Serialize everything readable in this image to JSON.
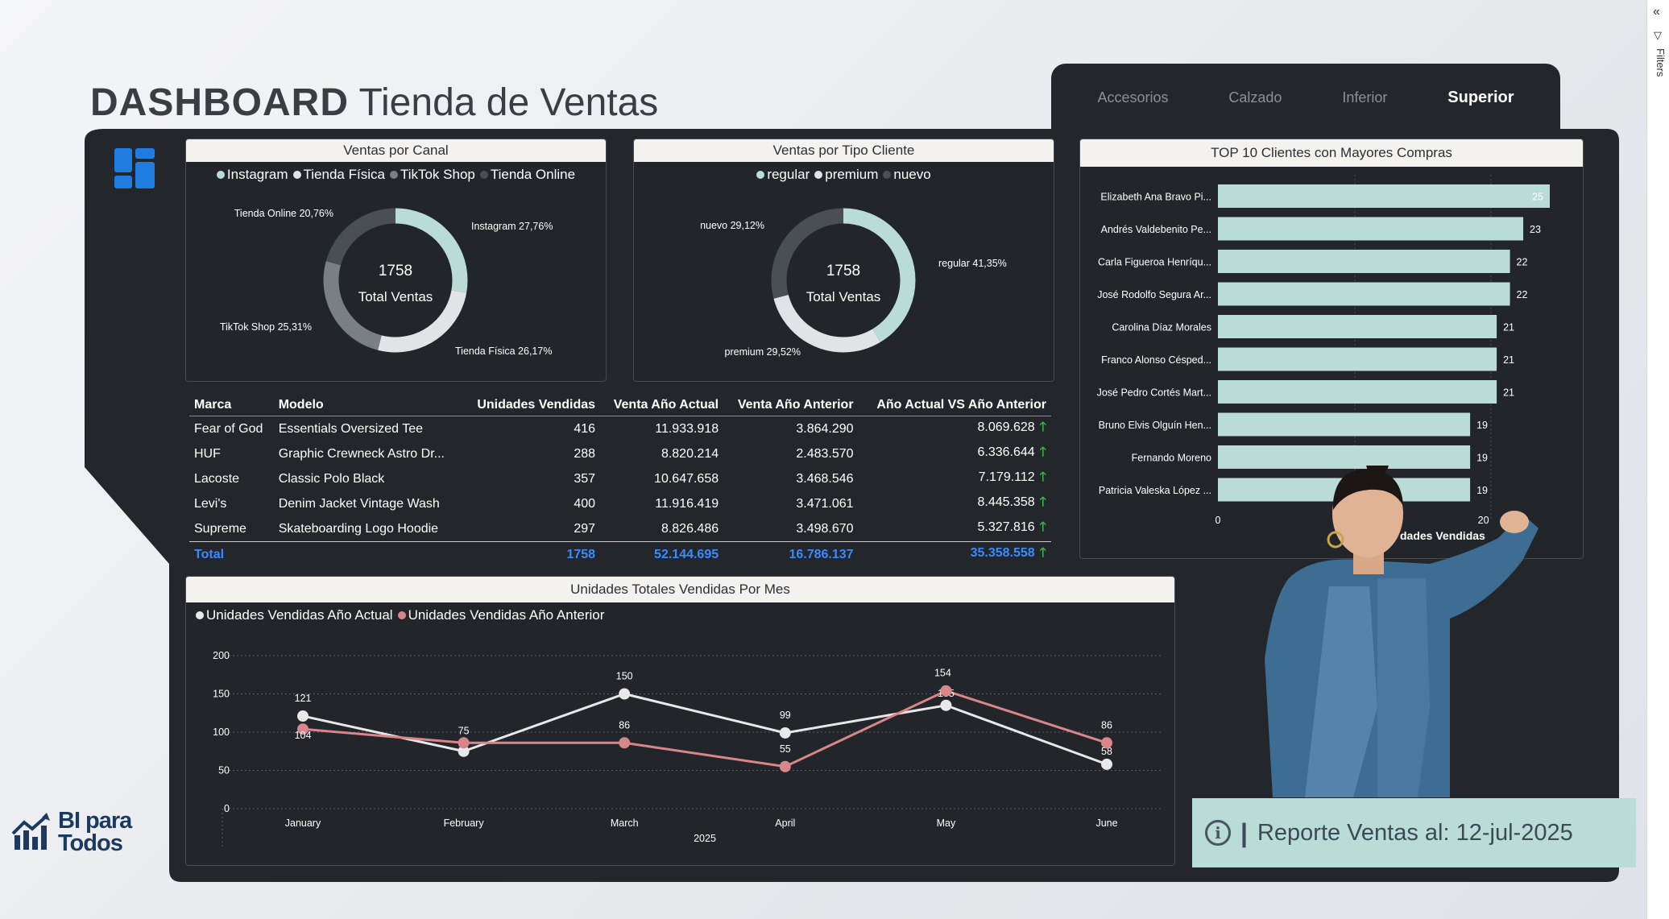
{
  "title": {
    "bold": "DASHBOARD",
    "rest": "Tienda de Ventas"
  },
  "tabs": [
    {
      "label": "Accesorios",
      "active": false
    },
    {
      "label": "Calzado",
      "active": false
    },
    {
      "label": "Inferior",
      "active": false
    },
    {
      "label": "Superior",
      "active": true
    }
  ],
  "filters_pane": {
    "label": "Filters"
  },
  "donut_canal": {
    "header": "Ventas por Canal",
    "center_value": "1758",
    "center_label": "Total Ventas",
    "legend": [
      "Instagram",
      "Tienda Física",
      "TikTok Shop",
      "Tienda Online"
    ],
    "slices": [
      {
        "name": "Instagram",
        "pct": 27.76,
        "label": "Instagram 27,76%",
        "color": "#b9dcd7"
      },
      {
        "name": "Tienda Física",
        "pct": 26.17,
        "label": "Tienda Física 26,17%",
        "color": "#e2e3e6"
      },
      {
        "name": "TikTok Shop",
        "pct": 25.31,
        "label": "TikTok Shop 25,31%",
        "color": "#7a7e85"
      },
      {
        "name": "Tienda Online",
        "pct": 20.76,
        "label": "Tienda Online 20,76%",
        "color": "#4a4e55"
      }
    ]
  },
  "donut_cliente": {
    "header": "Ventas por Tipo Cliente",
    "center_value": "1758",
    "center_label": "Total Ventas",
    "legend": [
      "regular",
      "premium",
      "nuevo"
    ],
    "slices": [
      {
        "name": "regular",
        "pct": 41.35,
        "label": "regular 41,35%",
        "color": "#b9dcd7"
      },
      {
        "name": "premium",
        "pct": 29.52,
        "label": "premium 29,52%",
        "color": "#e2e3e6"
      },
      {
        "name": "nuevo",
        "pct": 29.12,
        "label": "nuevo 29,12%",
        "color": "#4a4e55"
      }
    ]
  },
  "sales_table": {
    "columns": [
      "Marca",
      "Modelo",
      "Unidades Vendidas",
      "Venta Año Actual",
      "Venta Año Anterior",
      "Año Actual VS Año Anterior"
    ],
    "rows": [
      [
        "Fear of God",
        "Essentials Oversized Tee",
        "416",
        "11.933.918",
        "3.864.290",
        "8.069.628"
      ],
      [
        "HUF",
        "Graphic Crewneck Astro Dr...",
        "288",
        "8.820.214",
        "2.483.570",
        "6.336.644"
      ],
      [
        "Lacoste",
        "Classic Polo Black",
        "357",
        "10.647.658",
        "3.468.546",
        "7.179.112"
      ],
      [
        "Levi's",
        "Denim Jacket Vintage Wash",
        "400",
        "11.916.419",
        "3.471.061",
        "8.445.358"
      ],
      [
        "Supreme",
        "Skateboarding Logo Hoodie",
        "297",
        "8.826.486",
        "3.498.670",
        "5.327.816"
      ]
    ],
    "total": [
      "Total",
      "",
      "1758",
      "52.144.695",
      "16.786.137",
      "35.358.558"
    ],
    "arrow_symbol": "🡑"
  },
  "chart_data": [
    {
      "type": "bar",
      "title": "TOP 10 Clientes con Mayores Compras",
      "orientation": "horizontal",
      "categories": [
        "Elizabeth Ana Bravo Pi...",
        "Andrés Valdebenito Pe...",
        "Carla Figueroa Henríqu...",
        "José Rodolfo Segura Ar...",
        "Carolina Díaz Morales",
        "Franco Alonso Césped...",
        "José Pedro Cortés Mart...",
        "Bruno Elvis Olguín Hen...",
        "Fernando Moreno",
        "Patricia Valeska López ..."
      ],
      "values": [
        25,
        23,
        22,
        22,
        21,
        21,
        21,
        19,
        19,
        19
      ],
      "xlabel": "dades Vendidas",
      "xticks": [
        "0",
        "20"
      ],
      "xlim": [
        0,
        25
      ],
      "color": "#b9dcd7"
    },
    {
      "type": "line",
      "title": "Unidades Totales Vendidas Por Mes",
      "categories": [
        "January",
        "February",
        "March",
        "April",
        "May",
        "June"
      ],
      "xlabel": "2025",
      "ylim": [
        0,
        200
      ],
      "yticks": [
        "0",
        "50",
        "100",
        "150",
        "200"
      ],
      "series": [
        {
          "name": "Unidades Vendidas Año Actual",
          "values": [
            121,
            75,
            150,
            99,
            135,
            58
          ],
          "color": "#e8e8ea",
          "labels": [
            "121",
            "",
            "150",
            "99",
            "135",
            "58"
          ]
        },
        {
          "name": "Unidades Vendidas Año Anterior",
          "values": [
            104,
            86,
            86,
            55,
            154,
            86
          ],
          "color": "#d9868a",
          "labels": [
            "104",
            "75",
            "86",
            "55",
            "154",
            "86"
          ]
        }
      ]
    }
  ],
  "report": {
    "text": "Reporte Ventas al: 12-jul-2025",
    "separator": "|",
    "icon": "i"
  },
  "logo": {
    "line1": "BI para",
    "line2": "Todos"
  }
}
